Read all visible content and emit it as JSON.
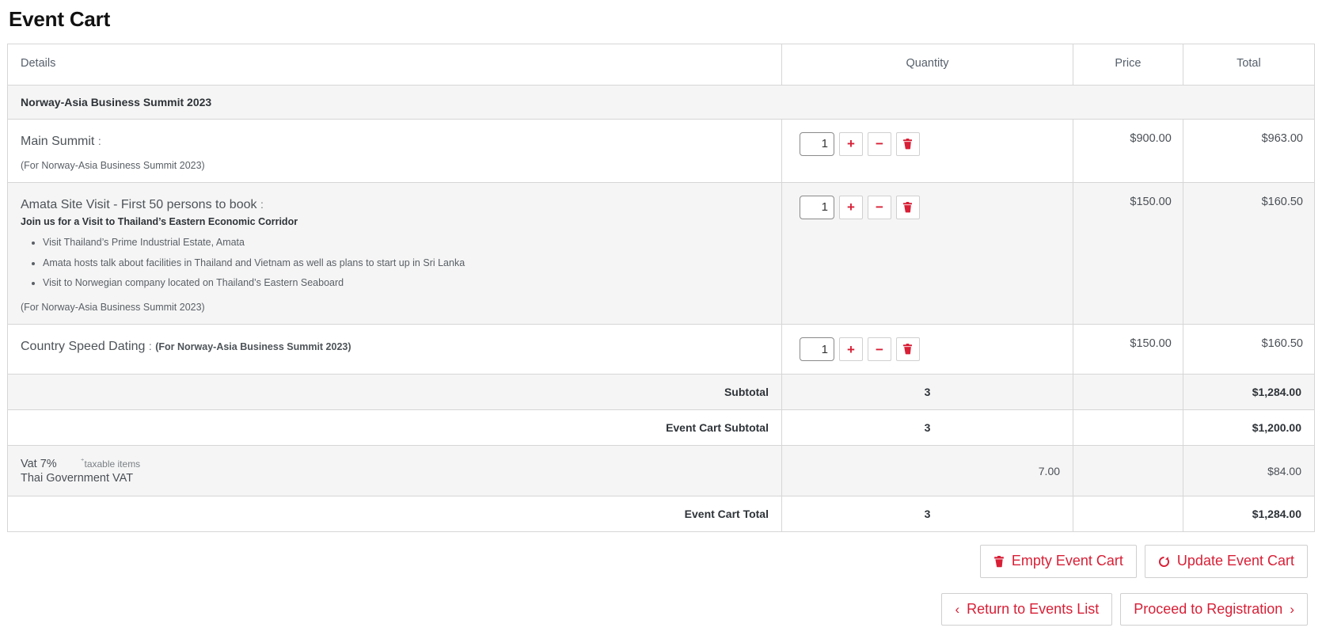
{
  "page": {
    "title": "Event Cart"
  },
  "colors": {
    "accent": "#d81f36",
    "border": "#d6d6d6",
    "row_shade": "#f5f5f5",
    "text": "#4a4f55"
  },
  "table": {
    "headers": {
      "details": "Details",
      "quantity": "Quantity",
      "price": "Price",
      "total": "Total"
    },
    "group_label": "Norway-Asia Business Summit 2023",
    "items": [
      {
        "title": "Main Summit",
        "colon": ":",
        "subtitle": "",
        "bullets": [],
        "for_text": "(For Norway-Asia Business Summit 2023)",
        "inline_for": "",
        "quantity": "1",
        "price": "$900.00",
        "total": "$963.00"
      },
      {
        "title": "Amata Site Visit - First 50 persons to book",
        "colon": ":",
        "subtitle": "Join us for a Visit to Thailand’s Eastern Economic Corridor",
        "bullets": [
          "Visit Thailand’s Prime Industrial Estate, Amata",
          "Amata hosts talk about facilities in Thailand and Vietnam as well as plans to start up in Sri Lanka",
          "Visit to Norwegian company located on Thailand’s Eastern Seaboard"
        ],
        "for_text": "(For Norway-Asia Business Summit 2023)",
        "inline_for": "",
        "quantity": "1",
        "price": "$150.00",
        "total": "$160.50"
      },
      {
        "title": "Country Speed Dating",
        "colon": ":",
        "subtitle": "",
        "bullets": [],
        "for_text": "",
        "inline_for": "(For Norway-Asia Business Summit 2023)",
        "quantity": "1",
        "price": "$150.00",
        "total": "$160.50"
      }
    ],
    "summary": [
      {
        "label": "Subtotal",
        "qty": "3",
        "total": "$1,284.00"
      },
      {
        "label": "Event Cart Subtotal",
        "qty": "3",
        "total": "$1,200.00"
      },
      {
        "label": "Event Cart Total",
        "qty": "3",
        "total": "$1,284.00"
      }
    ],
    "vat": {
      "name": "Vat 7%",
      "taxable_note": "taxable items",
      "taxable_marker": "⁺",
      "description": "Thai Government VAT",
      "rate": "7.00",
      "amount": "$84.00"
    }
  },
  "qty_controls": {
    "increase_label": "+",
    "decrease_label": "−",
    "remove_label": "remove"
  },
  "buttons": {
    "empty_cart": "Empty Event Cart",
    "update_cart": "Update Event Cart",
    "return_list": "Return to Events List",
    "proceed": "Proceed to Registration",
    "chevron_left": "‹",
    "chevron_right": "›"
  }
}
